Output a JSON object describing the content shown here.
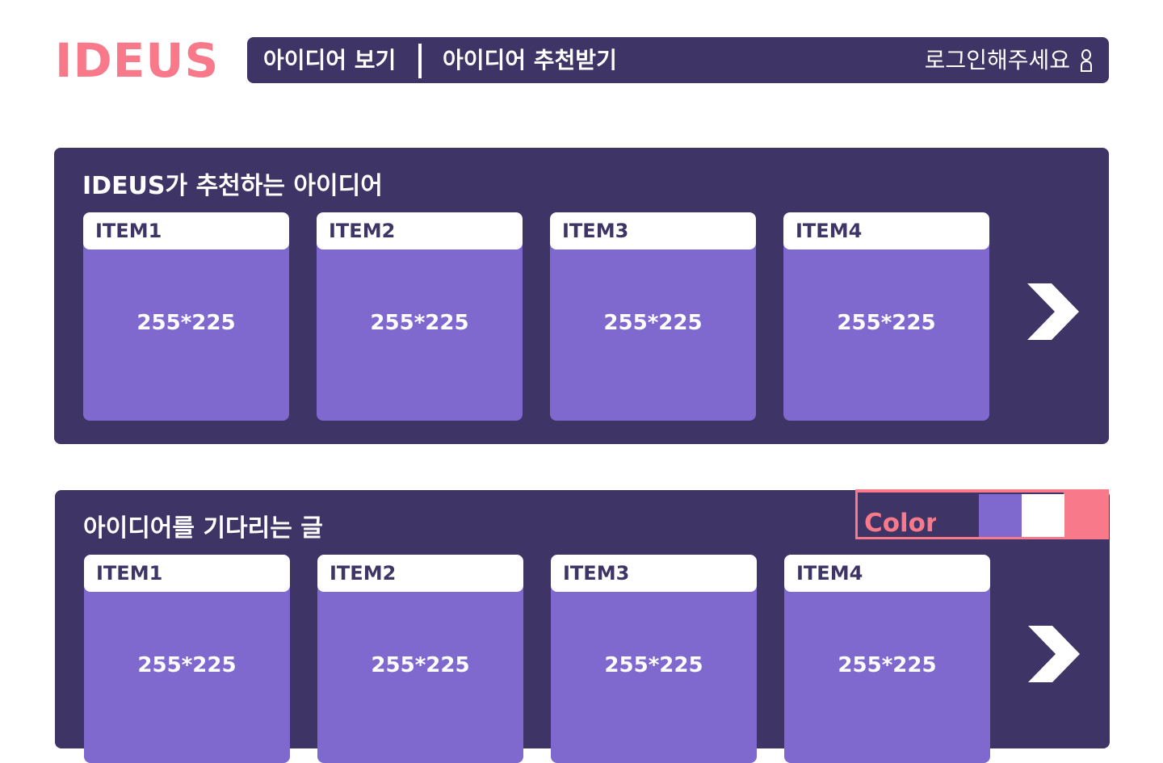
{
  "header": {
    "logo": "IDEUS",
    "nav": [
      {
        "label": "아이디어 보기"
      },
      {
        "label": "아이디어 추천받기"
      }
    ],
    "login_text": "로그인해주세요",
    "login_icon": "user-icon"
  },
  "sections": [
    {
      "title": "IDEUS가 추천하는 아이디어",
      "cards": [
        {
          "title": "ITEM1",
          "size_label": "255*225"
        },
        {
          "title": "ITEM2",
          "size_label": "255*225"
        },
        {
          "title": "ITEM3",
          "size_label": "255*225"
        },
        {
          "title": "ITEM4",
          "size_label": "255*225"
        }
      ],
      "next_icon": "chevron-right-icon"
    },
    {
      "title": "아이디어를 기다리는 글",
      "cards": [
        {
          "title": "ITEM1",
          "size_label": "255*225"
        },
        {
          "title": "ITEM2",
          "size_label": "255*225"
        },
        {
          "title": "ITEM3",
          "size_label": "255*225"
        },
        {
          "title": "ITEM4",
          "size_label": "255*225"
        }
      ],
      "next_icon": "chevron-right-icon"
    }
  ],
  "palette": {
    "label": "Color",
    "swatches": [
      "#3e3466",
      "#7f69cf",
      "#ffffff"
    ],
    "accent": "#f87a8a"
  }
}
